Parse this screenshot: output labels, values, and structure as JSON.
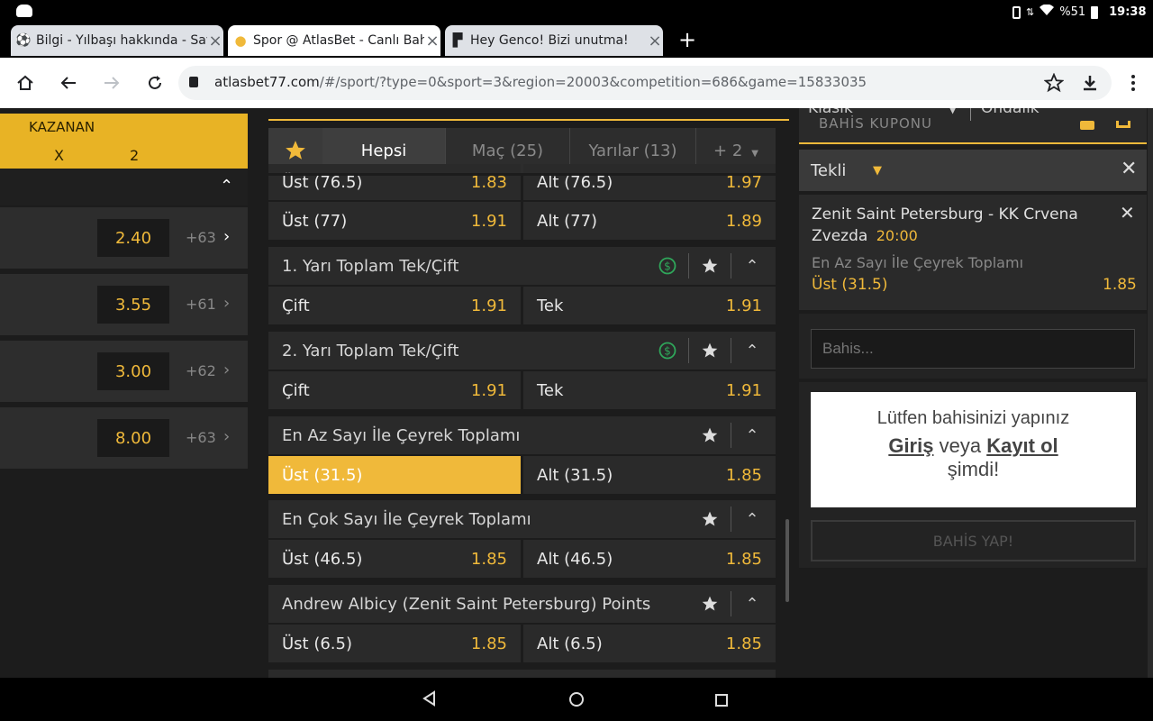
{
  "status_bar": {
    "battery": "%51",
    "time": "19:38"
  },
  "tabs": [
    {
      "title": "Bilgi - Yılbaşı hakkında - Sayfa",
      "icon": "soccer-ball-icon"
    },
    {
      "title": "Spor @ AtlasBet - Canlı Bahis",
      "icon": "location-pin-icon"
    },
    {
      "title": "Hey Genco! Bizi unutma!",
      "icon": "flag-icon"
    }
  ],
  "address": {
    "domain": "atlasbet77.com",
    "path": "/#/sport/?type=0&sport=3&region=20003&competition=686&game=15833035"
  },
  "left_panel": {
    "header": "KAZANAN",
    "cols": [
      "X",
      "2"
    ],
    "rows": [
      {
        "odd": "2.40",
        "more": "+63"
      },
      {
        "odd": "3.55",
        "more": "+61"
      },
      {
        "odd": "3.00",
        "more": "+62"
      },
      {
        "odd": "8.00",
        "more": "+63"
      }
    ]
  },
  "filter_tabs": [
    "Hepsi",
    "Maç (25)",
    "Yarılar (13)",
    "+ 2"
  ],
  "markets": {
    "top_rows": [
      {
        "l": "Üst (76.5)",
        "lo": "1.83",
        "r": "Alt (76.5)",
        "ro": "1.97"
      },
      {
        "l": "Üst (77)",
        "lo": "1.91",
        "r": "Alt (77)",
        "ro": "1.89"
      }
    ],
    "m1": {
      "title": "1. Yarı Toplam Tek/Çift",
      "l": "Çift",
      "lo": "1.91",
      "r": "Tek",
      "ro": "1.91"
    },
    "m2": {
      "title": "2. Yarı Toplam Tek/Çift",
      "l": "Çift",
      "lo": "1.91",
      "r": "Tek",
      "ro": "1.91"
    },
    "m3": {
      "title": "En Az Sayı İle Çeyrek Toplamı",
      "l": "Üst (31.5)",
      "lo": "",
      "r": "Alt (31.5)",
      "ro": "1.85"
    },
    "m4": {
      "title": "En Çok Sayı İle Çeyrek Toplamı",
      "l": "Üst (46.5)",
      "lo": "1.85",
      "r": "Alt (46.5)",
      "ro": "1.85"
    },
    "m5": {
      "title": "Andrew Albicy (Zenit Saint Petersburg) Points",
      "l": "Üst (6.5)",
      "lo": "1.85",
      "r": "Alt (6.5)",
      "ro": "1.85"
    }
  },
  "betslip": {
    "partial_top": {
      "left": "Klasik",
      "right": "Ondalık",
      "title": "BAHİS KUPONU"
    },
    "mode": "Tekli",
    "selection": {
      "match": "Zenit Saint Petersburg - KK Crvena Zvezda",
      "time": "20:00",
      "market": "En Az Sayı İle Çeyrek Toplamı",
      "pick": "Üst (31.5)",
      "odd": "1.85"
    },
    "stake_placeholder": "Bahis...",
    "login_prompt": "Lütfen bahisinizi yapınız",
    "login": "Giriş",
    "or": "veya",
    "register": "Kayıt ol",
    "now": "şimdi!",
    "place_bet": "BAHİS YAP!"
  },
  "colors": {
    "accent": "#f0b93a",
    "panel": "#2a2a2a",
    "bg": "#1c1c1c",
    "money_icon": "#2fa65a"
  }
}
